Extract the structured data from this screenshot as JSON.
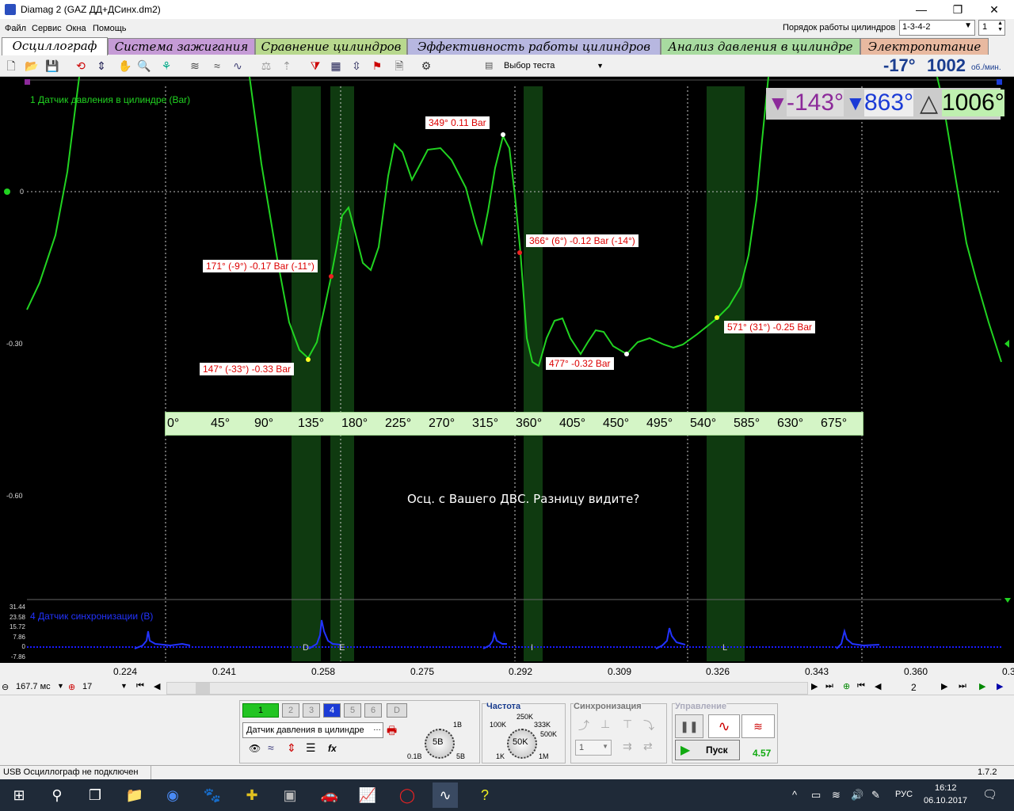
{
  "window": {
    "title": "Diamag 2 (GAZ ДД+ДСинх.dm2)",
    "minimize": "—",
    "maximize": "❐",
    "close": "✕"
  },
  "menu": [
    "Файл",
    "Сервис",
    "Окна",
    "Помощь"
  ],
  "cylinder_order": {
    "label": "Порядок работы цилиндров",
    "value": "1-3-4-2",
    "count": "1"
  },
  "tabs": [
    {
      "label": "Осциллограф",
      "color": "#ffffff"
    },
    {
      "label": "Система зажигания",
      "color": "#c59bd6"
    },
    {
      "label": "Сравнение цилиндров",
      "color": "#b8d88e"
    },
    {
      "label": "Эффективность работы цилиндров",
      "color": "#b7b7e0"
    },
    {
      "label": "Анализ давления в цилиндре",
      "color": "#a8dba0"
    },
    {
      "label": "Электропитание",
      "color": "#e8b9a0"
    }
  ],
  "toolbar": {
    "test_select": "Выбор теста",
    "angle": "-17°",
    "rpm": "1002",
    "rpm_unit": "об./мин."
  },
  "scope": {
    "channel1_label": "1 Датчик давления в цилиндре (Bar)",
    "channel4_label": "4 Датчик синхронизации (В)",
    "marker1": "-143°",
    "marker2": "863°",
    "delta": "1006°",
    "y_ticks": [
      "0",
      "-0.30",
      "-0.60"
    ],
    "sync_y_ticks": [
      "31.44",
      "23.58",
      "15.72",
      "7.86",
      "0",
      "-7.86"
    ],
    "angle_scale": [
      "0°",
      "45°",
      "90°",
      "135°",
      "180°",
      "225°",
      "270°",
      "315°",
      "360°",
      "405°",
      "450°",
      "495°",
      "540°",
      "585°",
      "630°",
      "675°"
    ],
    "phase_labels": [
      "D",
      "E",
      "I",
      "L"
    ],
    "time_ticks": [
      "0.224",
      "0.241",
      "0.258",
      "0.275",
      "0.292",
      "0.309",
      "0.326",
      "0.343",
      "0.360",
      "0.3"
    ],
    "annotations": [
      "349° 0.11 Bar",
      "171° (-9°) -0.17 Bar (-11°)",
      "366° (6°) -0.12 Bar (-14°)",
      "147° (-33°) -0.33 Bar",
      "477° -0.32 Bar",
      "571° (31°) -0.25 Bar"
    ],
    "comment": "Осц. с Вашего ДВС. Разницу видите?"
  },
  "navbar": {
    "time_per_div": "167.7 мс",
    "zoom": "17",
    "page": "2"
  },
  "channels": {
    "buttons": [
      "1",
      "2",
      "3",
      "4",
      "5",
      "6",
      "D"
    ],
    "sensor": "Датчик давления в цилиндре",
    "fx": "fx"
  },
  "voltage": {
    "value": "5В",
    "min": "0.1В",
    "max": "5В",
    "top": "1В"
  },
  "frequency": {
    "title": "Частота",
    "value": "50K",
    "marks": [
      "250K",
      "100K",
      "333K",
      "500K",
      "1K",
      "1M"
    ]
  },
  "sync": {
    "title": "Синхронизация",
    "channel": "1"
  },
  "control": {
    "title": "Управление",
    "start": "Пуск",
    "value": "4.57"
  },
  "status": {
    "text": "USB Осциллограф не подключен",
    "version": "1.7.2"
  },
  "taskbar": {
    "time": "16:12",
    "date": "06.10.2017",
    "lang": "РУС"
  }
}
